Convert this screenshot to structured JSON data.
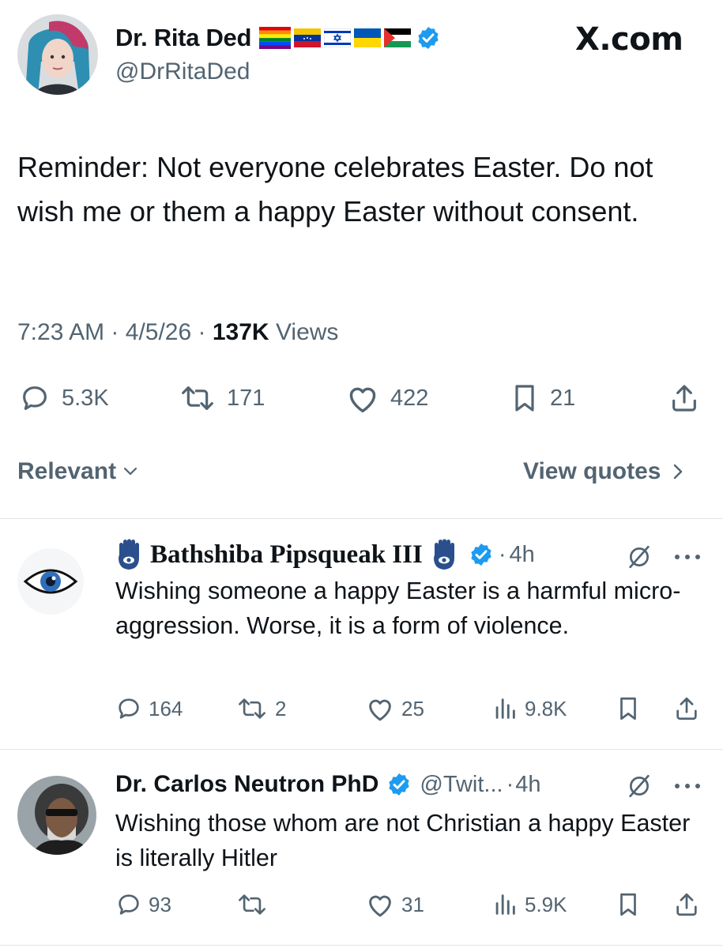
{
  "colors": {
    "accent": "#1d9bf0",
    "text": "#0f1419",
    "secondary": "#536471",
    "divider": "#e1e5e8"
  },
  "site_label": "X.com",
  "main_tweet": {
    "author_name": "Dr. Rita Ded",
    "author_flags": [
      "rainbow-flag",
      "venezuela-flag",
      "israel-flag",
      "ukraine-flag",
      "palestine-flag"
    ],
    "handle": "@DrRitaDed",
    "text": "Reminder: Not everyone celebrates Easter. Do not wish me or them a happy Easter without consent.",
    "time": "7:23 AM",
    "separator": "·",
    "date": "4/5/26",
    "views_count": "137K",
    "views_label": "Views",
    "replies": "5.3K",
    "reposts": "171",
    "likes": "422",
    "bookmarks": "21"
  },
  "sort": {
    "label": "Relevant",
    "view_quotes": "View quotes"
  },
  "replies": [
    {
      "author_name": "Bathshiba Pipsqueak III",
      "emoji": "hamsa-icon",
      "handle": "",
      "separator": "·",
      "time": "4h",
      "text": "Wishing someone a happy Easter is a harmful micro-aggression. Worse, it is a form of violence.",
      "replies": "164",
      "reposts": "2",
      "likes": "25",
      "views": "9.8K"
    },
    {
      "author_name": "Dr. Carlos Neutron PhD",
      "handle": "@Twit...",
      "separator": "·",
      "time": "4h",
      "text": "Wishing those whom are not Christian a happy Easter is literally Hitler",
      "replies": "93",
      "reposts": "",
      "likes": "31",
      "views": "5.9K"
    }
  ]
}
